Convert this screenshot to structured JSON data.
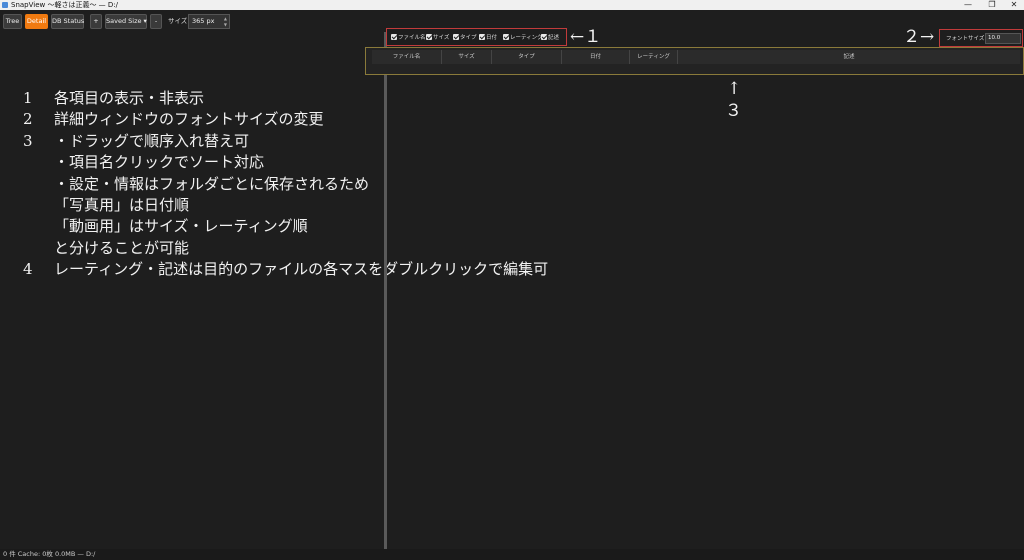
{
  "window": {
    "title": "SnapView 〜軽さは正義〜  —  D:/"
  },
  "toolbar": {
    "tree_label": "Tree",
    "detail_label": "Detail",
    "db_status_label": "DB Status",
    "plus_label": "+",
    "saved_size_label": "Saved Size ▾",
    "minus_label": "-",
    "size_label": "サイズ:",
    "size_value": "365 px"
  },
  "notes": [
    {
      "num": "1",
      "text": "各項目の表示・非表示"
    },
    {
      "num": "2",
      "text": "詳細ウィンドウのフォントサイズの変更"
    },
    {
      "num": "3",
      "text": "・ドラッグで順序入れ替え可"
    },
    {
      "num": "",
      "text": "・項目名クリックでソート対応"
    },
    {
      "num": "",
      "text": "・設定・情報はフォルダごとに保存されるため"
    },
    {
      "num": "",
      "text": "「写真用」は日付順"
    },
    {
      "num": "",
      "text": "「動画用」はサイズ・レーティング順"
    },
    {
      "num": "",
      "text": "と分けることが可能"
    },
    {
      "num": "4",
      "text": "レーティング・記述は目的のファイルの各マスをダブルクリックで編集可"
    }
  ],
  "columns_toggle": [
    {
      "label": "ファイル名",
      "checked": true
    },
    {
      "label": "サイズ",
      "checked": true
    },
    {
      "label": "タイプ",
      "checked": true
    },
    {
      "label": "日付",
      "checked": true
    },
    {
      "label": "レーティング",
      "checked": true
    },
    {
      "label": "記述",
      "checked": true
    }
  ],
  "annotations": {
    "a1": "←１",
    "a2": "２→",
    "a3_arrow": "↑",
    "a3_num": "３"
  },
  "font_size": {
    "label": "フォントサイズ:",
    "value": "10.0"
  },
  "table": {
    "headers": [
      "ファイル名",
      "サイズ",
      "タイプ",
      "日付",
      "レーティング",
      "記述"
    ]
  },
  "status": {
    "text": "0 件  Cache: 0枚 0.0MB  — D:/"
  },
  "colors": {
    "accent": "#f07a10",
    "highlight": "#c23b3b",
    "header_outline": "#8a7a3a"
  }
}
